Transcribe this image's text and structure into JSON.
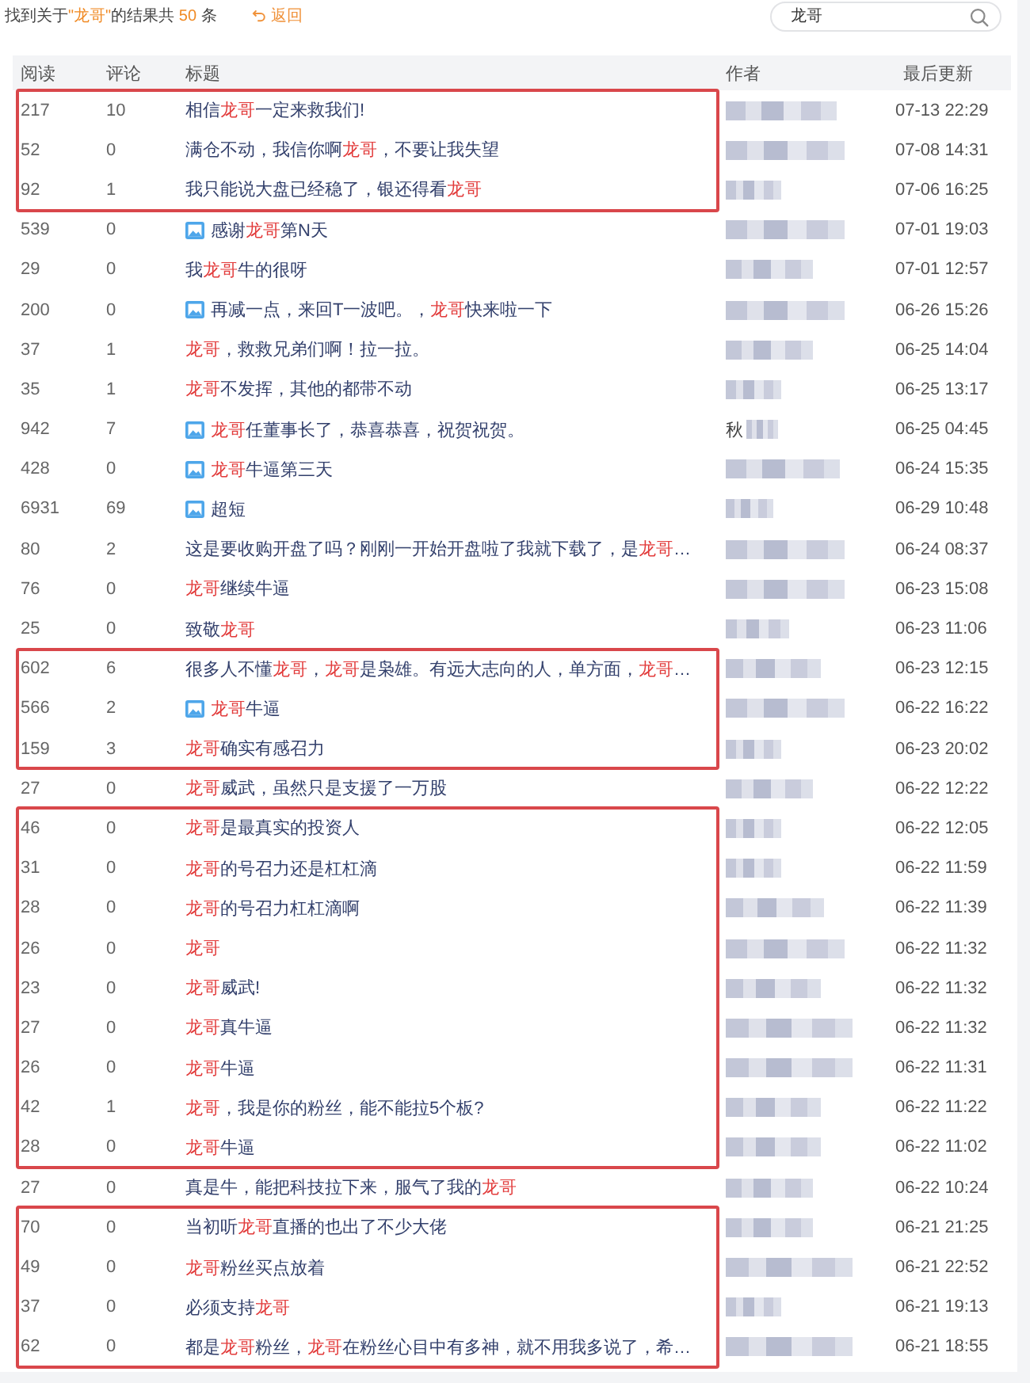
{
  "summary": [
    {
      "text": "找到关于",
      "highlight": false
    },
    {
      "text": "\"龙哥\"",
      "highlight": true
    },
    {
      "text": "的结果共 ",
      "highlight": false
    },
    {
      "text": "50",
      "highlight": true
    },
    {
      "text": " 条",
      "highlight": false
    }
  ],
  "back_link": "返回",
  "search": {
    "value": "龙哥"
  },
  "table": {
    "columns": [
      "阅读",
      "评论",
      "标题",
      "作者",
      "最后更新"
    ],
    "groups": [
      {
        "boxed": true,
        "rows": [
          {
            "reads": "217",
            "comments": "10",
            "has_image": false,
            "title": [
              {
                "text": "相信",
                "keyword": "龙哥"
              },
              {
                "text": "一定来救我们!"
              }
            ],
            "updated": "07-13 22:29"
          },
          {
            "reads": "52",
            "comments": "0",
            "has_image": false,
            "title": [
              {
                "text": "满仓不动，我信你啊",
                "keyword": "龙哥"
              },
              {
                "text": "，不要让我失望"
              }
            ],
            "updated": "07-08 14:31"
          },
          {
            "reads": "92",
            "comments": "1",
            "has_image": false,
            "title": [
              {
                "text": "我只能说大盘已经稳了，银还得看",
                "keyword": "龙哥"
              }
            ],
            "updated": "07-06 16:25"
          }
        ]
      },
      {
        "boxed": false,
        "rows": [
          {
            "reads": "539",
            "comments": "0",
            "has_image": true,
            "title": [
              {
                "text": "感谢",
                "keyword": "龙哥"
              },
              {
                "text": "第N天"
              }
            ],
            "updated": "07-01 19:03"
          },
          {
            "reads": "29",
            "comments": "0",
            "has_image": false,
            "title": [
              {
                "text": "我",
                "keyword": "龙哥"
              },
              {
                "text": "牛的很呀"
              }
            ],
            "updated": "07-01 12:57"
          },
          {
            "reads": "200",
            "comments": "0",
            "has_image": true,
            "title": [
              {
                "text": "再减一点，来回T一波吧。，",
                "keyword": "龙哥"
              },
              {
                "text": "快来啦一下"
              }
            ],
            "updated": "06-26 15:26"
          },
          {
            "reads": "37",
            "comments": "1",
            "has_image": false,
            "title": [
              {
                "keyword": "龙哥"
              },
              {
                "text": "，救救兄弟们啊！拉一拉。"
              }
            ],
            "updated": "06-25 14:04"
          },
          {
            "reads": "35",
            "comments": "1",
            "has_image": false,
            "title": [
              {
                "keyword": "龙哥"
              },
              {
                "text": "不发挥，其他的都带不动"
              }
            ],
            "updated": "06-25 13:17"
          },
          {
            "reads": "942",
            "comments": "7",
            "has_image": true,
            "title": [
              {
                "keyword": "龙哥"
              },
              {
                "text": "任董事长了，恭喜恭喜，祝贺祝贺。"
              }
            ],
            "author": "秋",
            "updated": "06-25 04:45"
          },
          {
            "reads": "428",
            "comments": "0",
            "has_image": true,
            "title": [
              {
                "keyword": "龙哥"
              },
              {
                "text": "牛逼第三天"
              }
            ],
            "updated": "06-24 15:35"
          },
          {
            "reads": "6931",
            "comments": "69",
            "has_image": true,
            "title": [
              {
                "text": "超短"
              }
            ],
            "updated": "06-29 10:48"
          },
          {
            "reads": "80",
            "comments": "2",
            "has_image": false,
            "title": [
              {
                "text": "这是要收购开盘了吗？刚刚一开始开盘啦了我就下载了，是",
                "keyword": "龙哥"
              },
              {
                "text": "…"
              }
            ],
            "updated": "06-24 08:37"
          },
          {
            "reads": "76",
            "comments": "0",
            "has_image": false,
            "title": [
              {
                "keyword": "龙哥"
              },
              {
                "text": "继续牛逼"
              }
            ],
            "updated": "06-23 15:08"
          },
          {
            "reads": "25",
            "comments": "0",
            "has_image": false,
            "title": [
              {
                "text": "致敬",
                "keyword": "龙哥"
              }
            ],
            "updated": "06-23 11:06"
          }
        ]
      },
      {
        "boxed": true,
        "rows": [
          {
            "reads": "602",
            "comments": "6",
            "has_image": false,
            "title": [
              {
                "text": "很多人不懂",
                "keyword": "龙哥"
              },
              {
                "text": "，",
                "keyword": "龙哥"
              },
              {
                "text": "是枭雄。有远大志向的人，单方面，",
                "keyword": "龙哥"
              },
              {
                "text": "…"
              }
            ],
            "updated": "06-23 12:15"
          },
          {
            "reads": "566",
            "comments": "2",
            "has_image": true,
            "title": [
              {
                "keyword": "龙哥"
              },
              {
                "text": "牛逼"
              }
            ],
            "updated": "06-22 16:22"
          },
          {
            "reads": "159",
            "comments": "3",
            "has_image": false,
            "title": [
              {
                "keyword": "龙哥"
              },
              {
                "text": "确实有感召力"
              }
            ],
            "updated": "06-23 20:02"
          }
        ]
      },
      {
        "boxed": false,
        "rows": [
          {
            "reads": "27",
            "comments": "0",
            "has_image": false,
            "title": [
              {
                "keyword": "龙哥"
              },
              {
                "text": "威武，虽然只是支援了一万股"
              }
            ],
            "updated": "06-22 12:22"
          }
        ]
      },
      {
        "boxed": true,
        "rows": [
          {
            "reads": "46",
            "comments": "0",
            "has_image": false,
            "title": [
              {
                "keyword": "龙哥"
              },
              {
                "text": "是最真实的投资人"
              }
            ],
            "updated": "06-22 12:05"
          },
          {
            "reads": "31",
            "comments": "0",
            "has_image": false,
            "title": [
              {
                "keyword": "龙哥"
              },
              {
                "text": "的号召力还是杠杠滴"
              }
            ],
            "updated": "06-22 11:59"
          },
          {
            "reads": "28",
            "comments": "0",
            "has_image": false,
            "title": [
              {
                "keyword": "龙哥"
              },
              {
                "text": "的号召力杠杠滴啊"
              }
            ],
            "updated": "06-22 11:39"
          },
          {
            "reads": "26",
            "comments": "0",
            "has_image": false,
            "title": [
              {
                "keyword": "龙哥"
              }
            ],
            "updated": "06-22 11:32"
          },
          {
            "reads": "23",
            "comments": "0",
            "has_image": false,
            "title": [
              {
                "keyword": "龙哥"
              },
              {
                "text": "威武!"
              }
            ],
            "updated": "06-22 11:32"
          },
          {
            "reads": "27",
            "comments": "0",
            "has_image": false,
            "title": [
              {
                "keyword": "龙哥"
              },
              {
                "text": "真牛逼"
              }
            ],
            "updated": "06-22 11:32"
          },
          {
            "reads": "26",
            "comments": "0",
            "has_image": false,
            "title": [
              {
                "keyword": "龙哥"
              },
              {
                "text": "牛逼"
              }
            ],
            "updated": "06-22 11:31"
          },
          {
            "reads": "42",
            "comments": "1",
            "has_image": false,
            "title": [
              {
                "keyword": "龙哥"
              },
              {
                "text": "，我是你的粉丝，能不能拉5个板?"
              }
            ],
            "updated": "06-22 11:22"
          },
          {
            "reads": "28",
            "comments": "0",
            "has_image": false,
            "title": [
              {
                "keyword": "龙哥"
              },
              {
                "text": "牛逼"
              }
            ],
            "updated": "06-22 11:02"
          }
        ]
      },
      {
        "boxed": false,
        "rows": [
          {
            "reads": "27",
            "comments": "0",
            "has_image": false,
            "title": [
              {
                "text": "真是牛，能把科技拉下来，服气了我的",
                "keyword": "龙哥"
              }
            ],
            "updated": "06-22 10:24"
          }
        ]
      },
      {
        "boxed": true,
        "rows": [
          {
            "reads": "70",
            "comments": "0",
            "has_image": false,
            "title": [
              {
                "text": "当初听",
                "keyword": "龙哥"
              },
              {
                "text": "直播的也出了不少大佬"
              }
            ],
            "updated": "06-21 21:25"
          },
          {
            "reads": "49",
            "comments": "0",
            "has_image": false,
            "title": [
              {
                "keyword": "龙哥"
              },
              {
                "text": "粉丝买点放着"
              }
            ],
            "updated": "06-21 22:52"
          },
          {
            "reads": "37",
            "comments": "0",
            "has_image": false,
            "title": [
              {
                "text": "必须支持",
                "keyword": "龙哥"
              }
            ],
            "updated": "06-21 19:13"
          },
          {
            "reads": "62",
            "comments": "0",
            "has_image": false,
            "title": [
              {
                "text": "都是",
                "keyword": "龙哥"
              },
              {
                "text": "粉丝，",
                "keyword": "龙哥"
              },
              {
                "text": "在粉丝心目中有多神，就不用我多说了，希…"
              }
            ],
            "updated": "06-21 18:55"
          }
        ]
      }
    ]
  }
}
